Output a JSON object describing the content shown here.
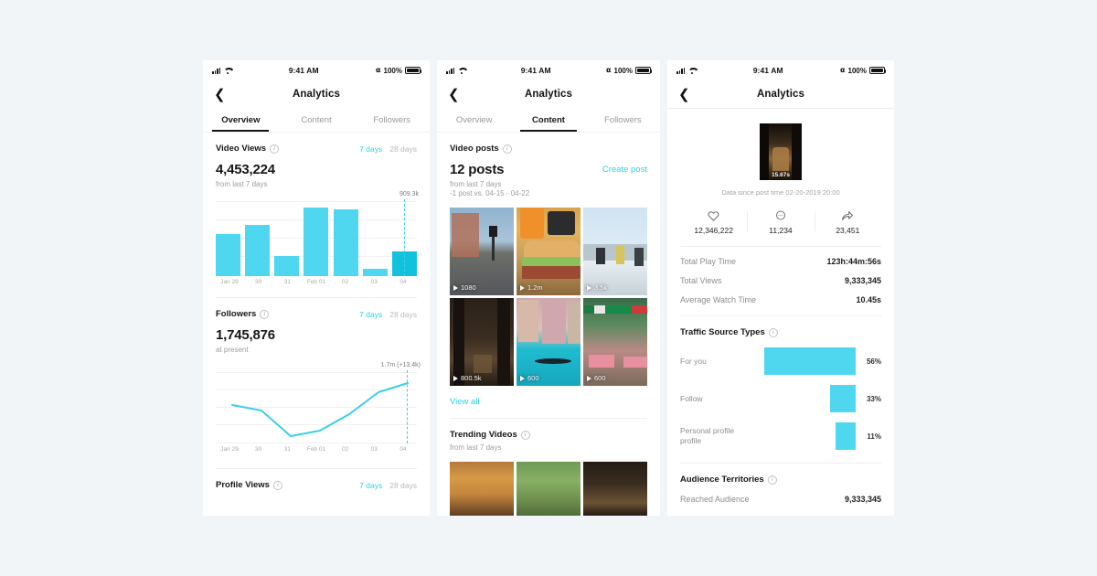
{
  "page": {
    "background": "#f2f5f8",
    "accent": "#25d3e8",
    "bar_color": "#4ed7ef",
    "bar_highlight": "#12c2dd"
  },
  "status_bar": {
    "time": "9:41 AM",
    "battery": "100%",
    "bluetooth_icon": "bluetooth-icon",
    "wifi_icon": "wifi-icon",
    "signal_icon": "cellular-signal-icon"
  },
  "phone1": {
    "nav": {
      "back_icon": "back-chevron-icon",
      "title": "Analytics"
    },
    "tabs": [
      {
        "label": "Overview",
        "active": true
      },
      {
        "label": "Content",
        "active": false
      },
      {
        "label": "Followers",
        "active": false
      }
    ],
    "video_views": {
      "title": "Video Views",
      "info_icon": "info-icon",
      "range_7": "7 days",
      "range_28": "28 days",
      "value": "4,453,224",
      "note": "from last 7 days",
      "peak_label": "909.3k"
    },
    "followers": {
      "title": "Followers",
      "info_icon": "info-icon",
      "range_7": "7 days",
      "range_28": "28 days",
      "value": "1,745,876",
      "note": "at present",
      "peak_label": "1.7m (+13.4k)"
    },
    "profile_views": {
      "title": "Profile Views",
      "info_icon": "info-icon",
      "range_7": "7 days",
      "range_28": "28 days"
    }
  },
  "phone2": {
    "nav": {
      "back_icon": "back-chevron-icon",
      "title": "Analytics"
    },
    "tabs": [
      {
        "label": "Overview",
        "active": false
      },
      {
        "label": "Content",
        "active": true
      },
      {
        "label": "Followers",
        "active": false
      }
    ],
    "video_posts": {
      "title": "Video posts",
      "info_icon": "info-icon",
      "count": "12 posts",
      "create_post": "Create post",
      "note1": "from last 7 days",
      "note2": "-1 post vs. 04-15 - 04-22"
    },
    "grid": [
      {
        "views": "1080",
        "play_icon": "play-icon",
        "theme": "city-street"
      },
      {
        "views": "1.2m",
        "play_icon": "play-icon",
        "theme": "burger"
      },
      {
        "views": "3.5k",
        "play_icon": "play-icon",
        "theme": "snow"
      },
      {
        "views": "800.5k",
        "play_icon": "play-icon",
        "theme": "corridor"
      },
      {
        "views": "600",
        "play_icon": "play-icon",
        "theme": "venice"
      },
      {
        "views": "600",
        "play_icon": "play-icon",
        "theme": "cafe"
      }
    ],
    "view_all": "View all",
    "trending": {
      "title": "Trending Videos",
      "info_icon": "info-icon",
      "note": "from last 7 days",
      "items": [
        {
          "theme": "burger2"
        },
        {
          "theme": "deer"
        },
        {
          "theme": "hall"
        }
      ]
    }
  },
  "phone3": {
    "nav": {
      "back_icon": "back-chevron-icon",
      "title": "Analytics"
    },
    "video": {
      "duration": "15.67s",
      "since": "Data since post time 02-20-2019 20:00"
    },
    "engagement": [
      {
        "icon": "heart-icon",
        "value": "12,346,222"
      },
      {
        "icon": "comment-icon",
        "value": "11,234"
      },
      {
        "icon": "share-icon",
        "value": "23,451"
      }
    ],
    "stats": [
      {
        "key": "Total Play Time",
        "value": "123h:44m:56s"
      },
      {
        "key": "Total Views",
        "value": "9,333,345"
      },
      {
        "key": "Average Watch Time",
        "value": "10.45s"
      }
    ],
    "traffic": {
      "title": "Traffic Source Types",
      "info_icon": "info-icon"
    },
    "territories": {
      "title": "Audience Territories",
      "info_icon": "info-icon",
      "reached_key": "Reached Audience",
      "reached_value": "9,333,345"
    }
  },
  "chart_data": [
    {
      "type": "bar",
      "title": "Video Views",
      "categories": [
        "Jan 29",
        "30",
        "31",
        "Feb 01",
        "02",
        "03",
        "04"
      ],
      "values": [
        540,
        660,
        260,
        880,
        860,
        90,
        320
      ],
      "ylim": [
        0,
        960
      ],
      "peak_annotation": "909.3k",
      "highlight_index": 6,
      "grid": true,
      "xlabel": "",
      "ylabel": ""
    },
    {
      "type": "line",
      "title": "Followers",
      "x": [
        "Jan 29",
        "30",
        "31",
        "Feb 01",
        "02",
        "03",
        "04"
      ],
      "values": [
        54,
        48,
        8,
        17,
        38,
        74,
        88
      ],
      "ylim": [
        0,
        100
      ],
      "peak_annotation": "1.7m (+13.4k)",
      "grid": true
    },
    {
      "type": "bar",
      "title": "Traffic Source Types",
      "orientation": "horizontal",
      "categories": [
        "For you",
        "Follow",
        "Personal profile profile"
      ],
      "values": [
        56,
        33,
        11
      ],
      "value_labels": [
        "56%",
        "33%",
        "11%"
      ],
      "unit": "%"
    }
  ]
}
